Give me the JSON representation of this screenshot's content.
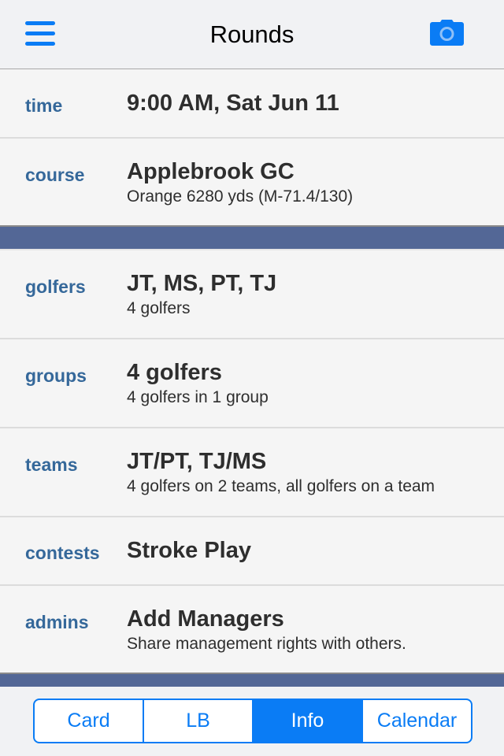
{
  "header": {
    "title": "Rounds",
    "left_icon": "hamburger-menu-icon",
    "right_icon": "camera-icon"
  },
  "rows": [
    {
      "label": "time",
      "value": "9:00 AM, Sat Jun 11",
      "sub": ""
    },
    {
      "label": "course",
      "value": "Applebrook GC",
      "sub": "Orange 6280 yds (M-71.4/130)"
    },
    {
      "label": "golfers",
      "value": "JT, MS, PT, TJ",
      "sub": "4 golfers"
    },
    {
      "label": "groups",
      "value": "4 golfers",
      "sub": "4 golfers in 1 group"
    },
    {
      "label": "teams",
      "value": "JT/PT, TJ/MS",
      "sub": "4 golfers on 2 teams, all golfers on a team"
    },
    {
      "label": "contests",
      "value": "Stroke Play",
      "sub": ""
    },
    {
      "label": "admins",
      "value": "Add Managers",
      "sub": "Share management rights with others."
    }
  ],
  "tabs": [
    {
      "label": "Card",
      "active": false
    },
    {
      "label": "LB",
      "active": false
    },
    {
      "label": "Info",
      "active": true
    },
    {
      "label": "Calendar",
      "active": false
    }
  ],
  "colors": {
    "accent": "#0a7cf5",
    "label": "#35689a",
    "separator_band": "#536796"
  }
}
